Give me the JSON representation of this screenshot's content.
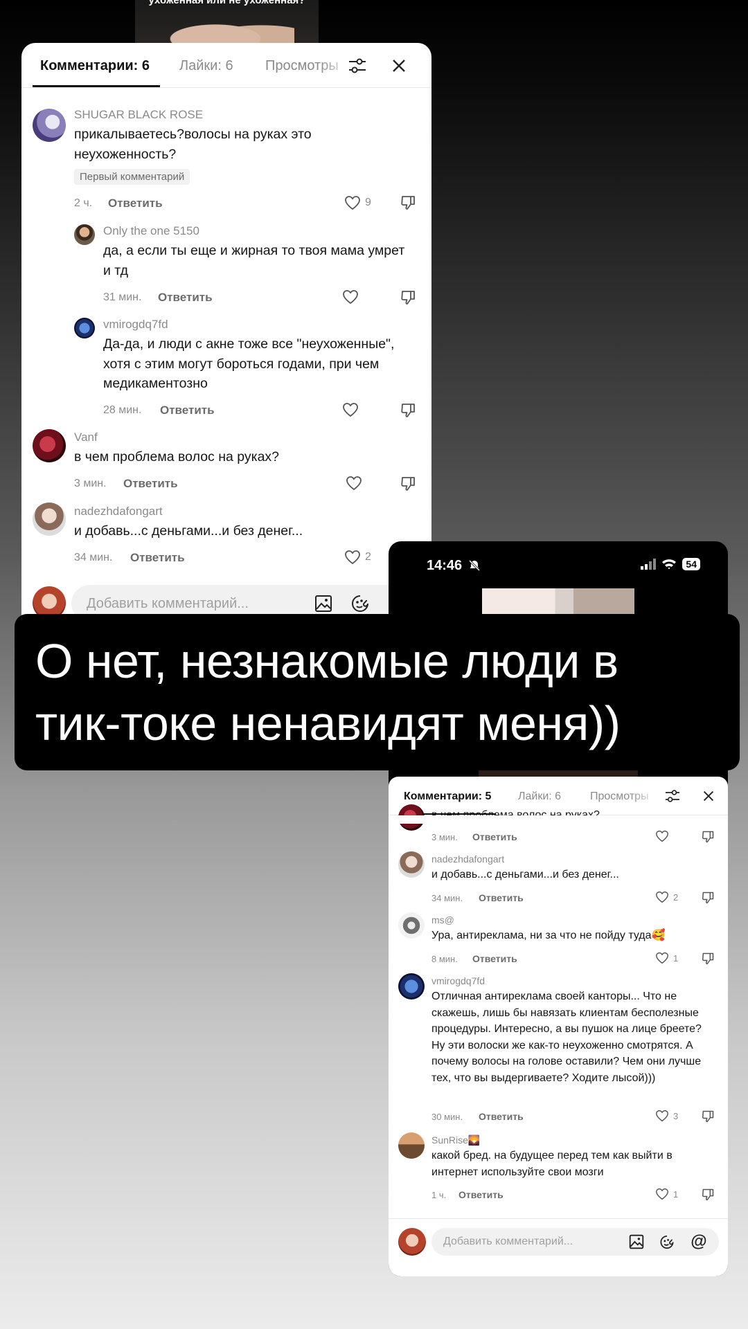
{
  "video_caption": "ухоженная или не ухоженная?",
  "panel1": {
    "tabs": [
      "Комментарии: 6",
      "Лайки: 6",
      "Просмотры"
    ],
    "icons": {
      "filter": "filter-sliders-icon",
      "close": "close-icon"
    },
    "comments": [
      {
        "user": "SHUGAR BLACK ROSE",
        "text": "прикалываетесь?волосы на руках это неухоженность?",
        "badge": "Первый комментарий",
        "time": "2 ч.",
        "reply": "Ответить",
        "likes": "9"
      },
      {
        "user": "Only the one 5150",
        "text": "да, а если ты еще и жирная то твоя мама умрет и тд",
        "time": "31 мин.",
        "reply": "Ответить",
        "likes": ""
      },
      {
        "user": "vmirogdq7fd",
        "text": "Да-да, и люди с акне тоже все \"неухоженные\", хотя с этим могут бороться годами, при чем медикаментозно",
        "time": "28 мин.",
        "reply": "Ответить",
        "likes": ""
      },
      {
        "user": "Vanf",
        "text": "в чем проблема волос на руках?",
        "time": "3 мин.",
        "reply": "Ответить",
        "likes": ""
      },
      {
        "user": "nadezhdafongart",
        "text": "и добавь...с деньгами...и без денег...",
        "time": "34 мин.",
        "reply": "Ответить",
        "likes": "2"
      }
    ],
    "input_placeholder": "Добавить комментарий..."
  },
  "phone": {
    "status_time": "14:46",
    "battery": "54"
  },
  "panel2": {
    "tabs": [
      "Комментарии: 5",
      "Лайки: 6",
      "Просмотры"
    ],
    "partial_comment": {
      "text": "в чем проблема волос на руках?",
      "time": "3 мин.",
      "reply": "Ответить",
      "likes": ""
    },
    "comments": [
      {
        "user": "nadezhdafongart",
        "text": "и добавь...с деньгами...и без денег...",
        "time": "34 мин.",
        "reply": "Ответить",
        "likes": "2"
      },
      {
        "user": "ms@",
        "text": "Ура, антиреклама, ни за что не пойду туда🥰",
        "time": "8 мин.",
        "reply": "Ответить",
        "likes": "1"
      },
      {
        "user": "vmirogdq7fd",
        "text": "Отличная антиреклама своей канторы... Что не скажешь, лишь бы навязать клиентам бесполезные процедуры. Интересно, а вы пушок на лице бреете? Ну эти волоски же как-то неухоженно смотрятся. А почему волосы на голове оставили? Чем они лучше тех, что вы выдергиваете? Ходите лысой)))",
        "time": "30 мин.",
        "reply": "Ответить",
        "likes": "3"
      },
      {
        "user": "SunRise🌄",
        "text": "какой бред. на будущее перед тем как выйти в интернет используйте свои мозги",
        "time": "1 ч.",
        "reply": "Ответить",
        "likes": "1"
      }
    ],
    "input_placeholder": "Добавить комментарий..."
  },
  "caption": {
    "line1": "О нет, незнакомые люди  в",
    "line2": "тик-токе ненавидят меня))"
  },
  "colors": {
    "accent_text": "#161616",
    "meta_gray": "#8a8a8a",
    "panel_bg": "#ffffff"
  }
}
